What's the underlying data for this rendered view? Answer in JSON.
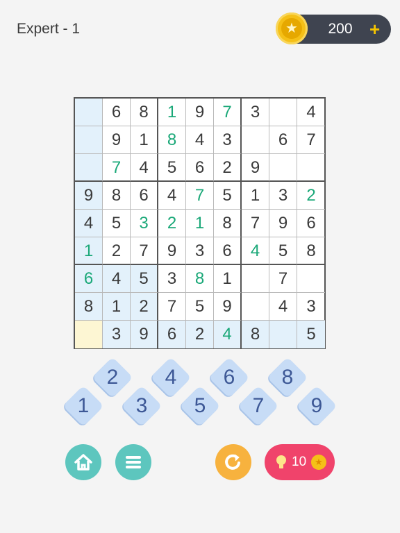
{
  "header": {
    "level_title": "Expert - 1",
    "coins": "200",
    "add_label": "+"
  },
  "colors": {
    "given": "#3a3a3a",
    "entered": "#1aa878",
    "highlight": "#e3f1fb",
    "selected": "#fdf6d3"
  },
  "board": {
    "selected_cell": [
      8,
      0
    ],
    "cells": [
      [
        "",
        "6",
        "8",
        "1",
        "9",
        "7",
        "3",
        "",
        "4"
      ],
      [
        "",
        "9",
        "1",
        "8",
        "4",
        "3",
        "",
        "6",
        "7"
      ],
      [
        "",
        "7",
        "4",
        "5",
        "6",
        "2",
        "9",
        "",
        ""
      ],
      [
        "9",
        "8",
        "6",
        "4",
        "7",
        "5",
        "1",
        "3",
        "2"
      ],
      [
        "4",
        "5",
        "3",
        "2",
        "1",
        "8",
        "7",
        "9",
        "6"
      ],
      [
        "1",
        "2",
        "7",
        "9",
        "3",
        "6",
        "4",
        "5",
        "8"
      ],
      [
        "6",
        "4",
        "5",
        "3",
        "8",
        "1",
        "",
        "7",
        ""
      ],
      [
        "8",
        "1",
        "2",
        "7",
        "5",
        "9",
        "",
        "4",
        "3"
      ],
      [
        "",
        "3",
        "9",
        "6",
        "2",
        "4",
        "8",
        "",
        "5"
      ]
    ],
    "entered": [
      [
        0,
        3
      ],
      [
        0,
        5
      ],
      [
        1,
        3
      ],
      [
        2,
        1
      ],
      [
        3,
        4
      ],
      [
        3,
        8
      ],
      [
        4,
        2
      ],
      [
        4,
        3
      ],
      [
        4,
        4
      ],
      [
        5,
        0
      ],
      [
        5,
        6
      ],
      [
        6,
        0
      ],
      [
        6,
        4
      ],
      [
        8,
        5
      ]
    ]
  },
  "keypad": {
    "numbers": [
      "1",
      "2",
      "3",
      "4",
      "5",
      "6",
      "7",
      "8",
      "9"
    ]
  },
  "controls": {
    "hint_count": "10",
    "home_icon": "home-icon",
    "menu_icon": "menu-icon",
    "undo_icon": "undo-icon"
  }
}
